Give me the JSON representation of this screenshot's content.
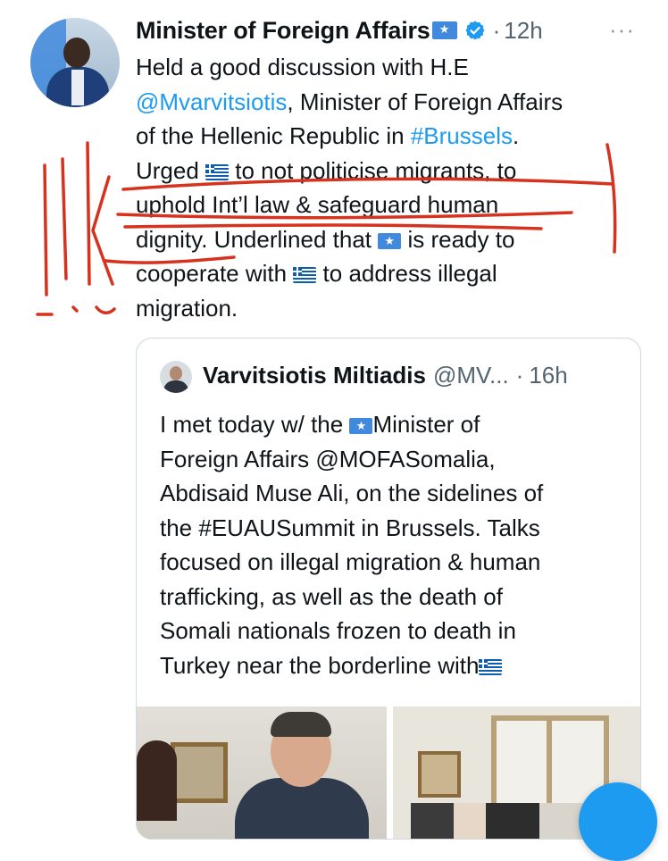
{
  "tweet": {
    "author_name": "Minister of Foreign Affairs",
    "timestamp": "12h",
    "separator": "·",
    "more": "···",
    "lines": [
      [
        "Held a good discussion with H.E"
      ],
      [
        "@Mvarvitsiotis",
        ", Minister of Foreign Affairs"
      ],
      [
        "of the Hellenic Republic in ",
        "#Brussels",
        "."
      ],
      [
        "Urged ",
        " to not politicise migrants, to"
      ],
      [
        "uphold Int’l law & safeguard human"
      ],
      [
        "dignity. Underlined that ",
        " is ready to"
      ],
      [
        "cooperate with ",
        " to address illegal"
      ],
      [
        "migration."
      ]
    ]
  },
  "quote": {
    "author_name": "Varvitsiotis Miltiadis",
    "handle": "@MV...",
    "separator": "·",
    "timestamp": "16h",
    "lines": [
      [
        "I met today w/ the ",
        "Minister of"
      ],
      [
        "Foreign Affairs @MOFASomalia,"
      ],
      [
        "Abdisaid Muse Ali, on the sidelines of"
      ],
      [
        "the #EUAUSummit in Brussels. Talks"
      ],
      [
        "focused on illegal migration & human"
      ],
      [
        "trafficking, as well as the death of"
      ],
      [
        "Somali nationals frozen to death in"
      ],
      [
        "Turkey near the borderline with"
      ]
    ]
  },
  "colors": {
    "link": "#1d9bf0",
    "annotation": "#d6321e",
    "verified": "#1d9bf0"
  },
  "icons": [
    "verified-badge-icon",
    "somalia-flag-icon",
    "greece-flag-icon",
    "more-icon",
    "compose-fab-icon"
  ]
}
